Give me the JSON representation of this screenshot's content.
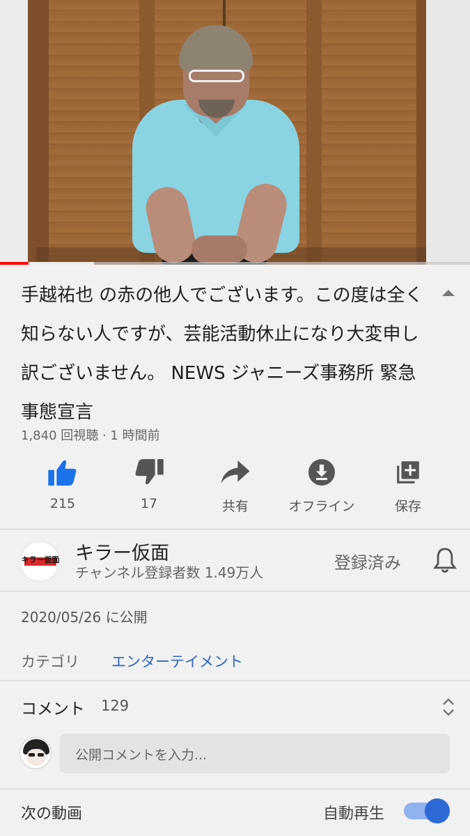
{
  "video": {
    "progress_fraction": 0.06
  },
  "info": {
    "title": "手越祐也 の赤の他人でございます。この度は全く知らない人ですが、芸能活動休止になり大変申し訳ございません。 NEWS ジャニーズ事務所 緊急事態宣言",
    "meta": "1,840 回視聴 · 1 時間前"
  },
  "actions": {
    "like_count": "215",
    "dislike_count": "17",
    "share_label": "共有",
    "offline_label": "オフライン",
    "save_label": "保存"
  },
  "channel": {
    "avatar_text": "キラー仮面",
    "name": "キラー仮面",
    "subscribers": "チャンネル登録者数 1.49万人",
    "subscribe_state": "登録済み"
  },
  "details": {
    "published": "2020/05/26 に公開",
    "category_label": "カテゴリ",
    "category_value": "エンターテイメント"
  },
  "comments": {
    "label": "コメント",
    "count": "129",
    "placeholder": "公開コメントを入力..."
  },
  "up_next": {
    "label": "次の動画",
    "autoplay_label": "自動再生",
    "autoplay_on": true
  },
  "colors": {
    "accent_blue": "#2e65c4",
    "like_blue": "#1a73e8",
    "progress_red": "#ff0000"
  }
}
